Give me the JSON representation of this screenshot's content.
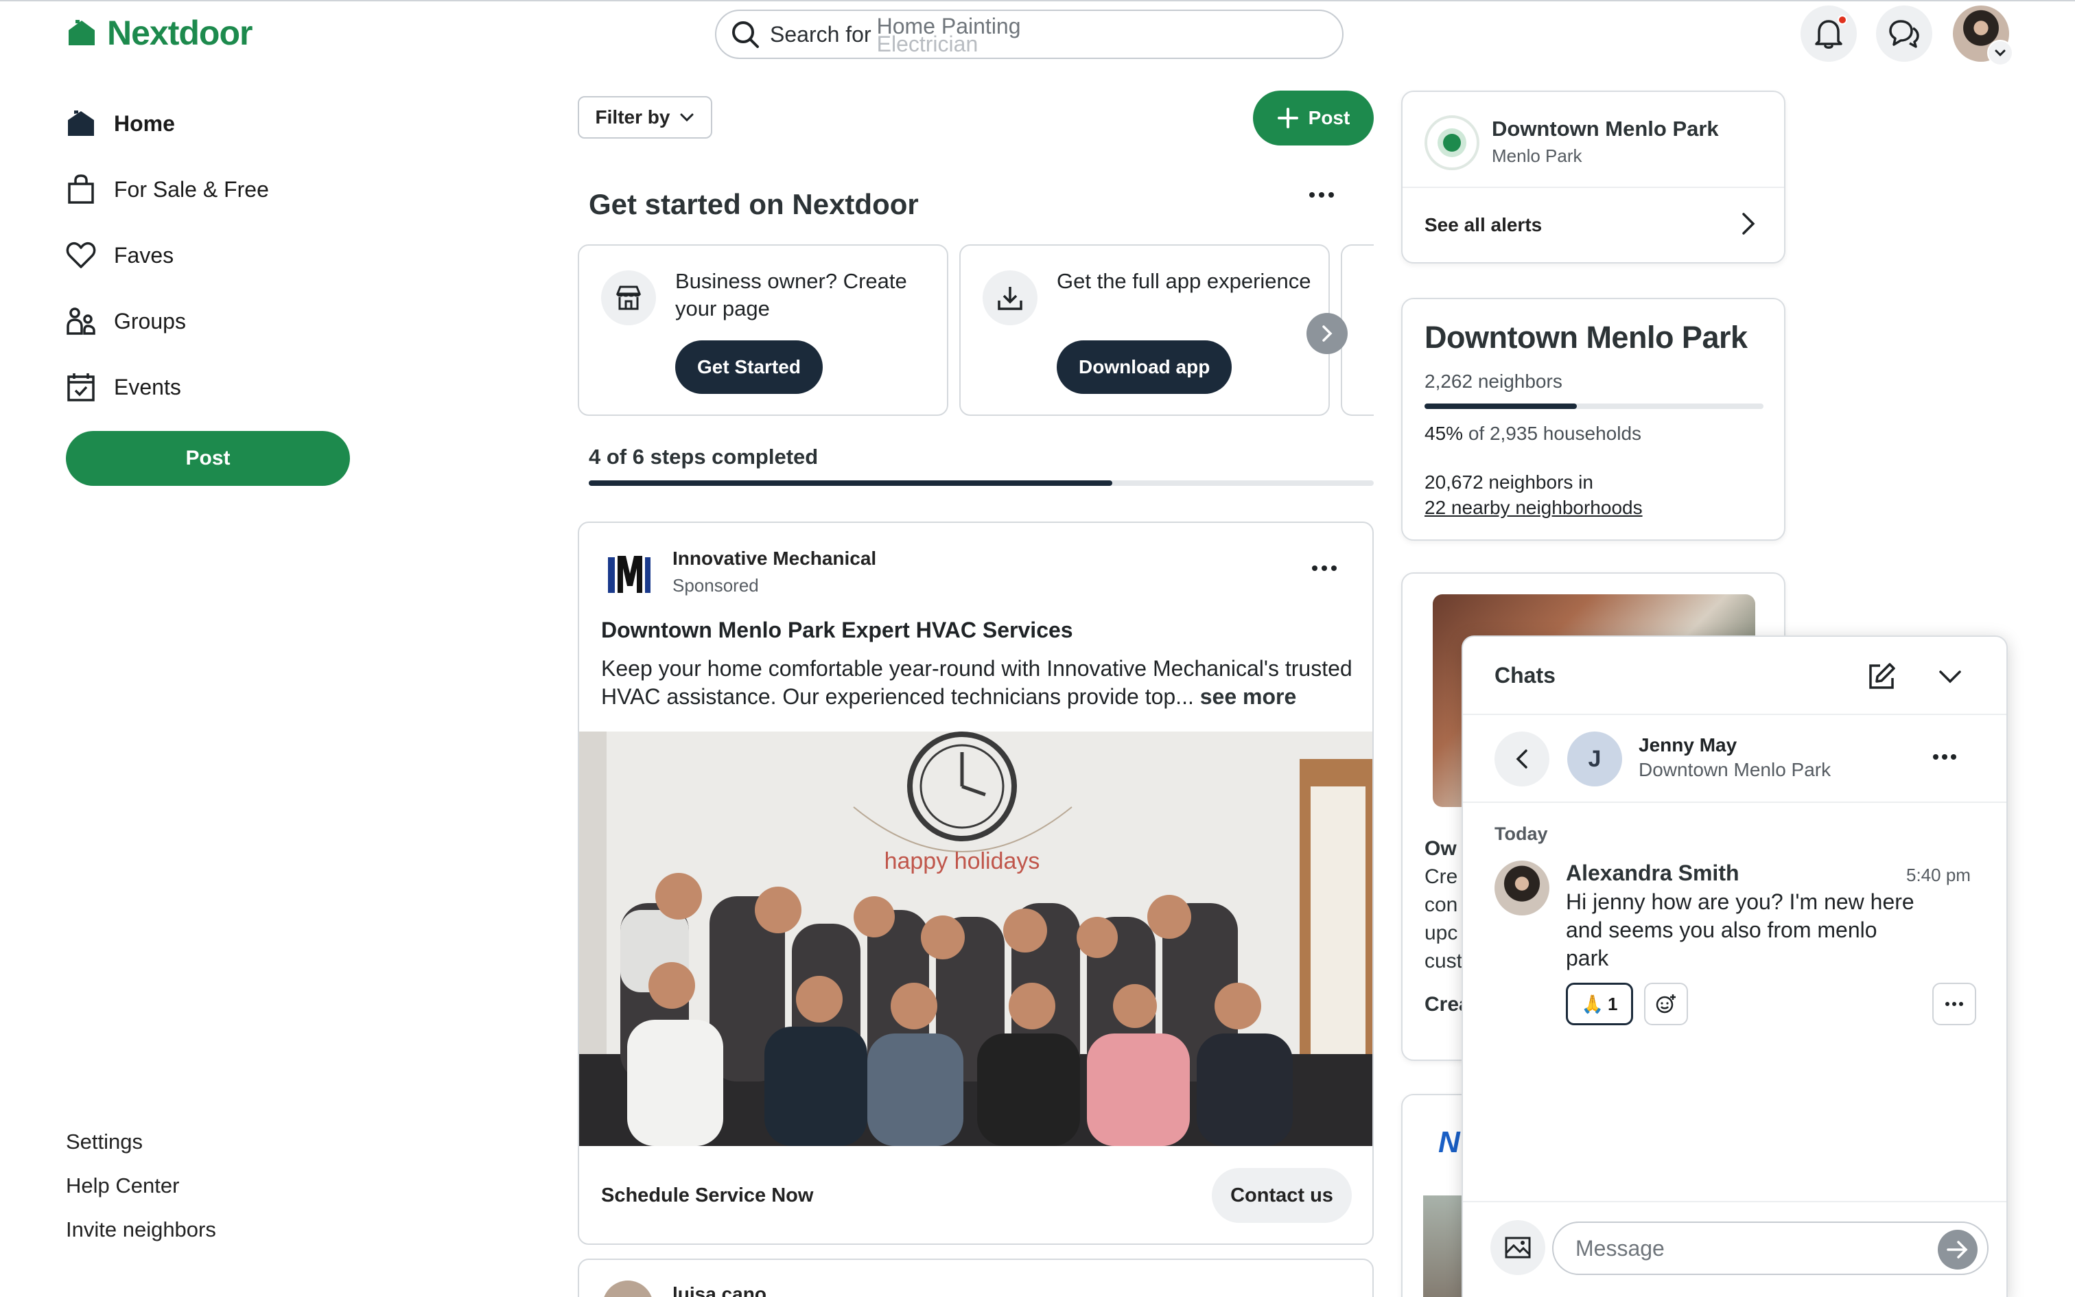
{
  "app": {
    "name": "Nextdoor",
    "brand_color": "#1d8a4d",
    "dark_color": "#1b2a3a"
  },
  "search": {
    "prefix": "Search for",
    "suggestion_current": "Home Painting",
    "suggestion_next": "Electrician"
  },
  "header": {
    "notification_icon": "bell-icon",
    "chat_icon": "chat-bubbles-icon",
    "has_unread_notification": true
  },
  "nav": {
    "items": [
      {
        "label": "Home",
        "icon": "home-icon",
        "active": true
      },
      {
        "label": "For Sale & Free",
        "icon": "shopping-bag-icon",
        "active": false
      },
      {
        "label": "Faves",
        "icon": "heart-icon",
        "active": false
      },
      {
        "label": "Groups",
        "icon": "people-icon",
        "active": false
      },
      {
        "label": "Events",
        "icon": "calendar-check-icon",
        "active": false
      }
    ],
    "post_label": "Post",
    "footer_links": [
      "Settings",
      "Help Center",
      "Invite neighbors"
    ]
  },
  "feed": {
    "filter_label": "Filter by",
    "post_label": "Post",
    "get_started": {
      "title": "Get started on Nextdoor",
      "cards": [
        {
          "text": "Business owner? Create your page",
          "button": "Get Started",
          "icon": "storefront-icon"
        },
        {
          "text": "Get the full app experience",
          "button": "Download app",
          "icon": "download-icon"
        }
      ],
      "steps_text": "4 of 6 steps completed",
      "steps_done": 4,
      "steps_total": 6
    },
    "ad": {
      "company": "Innovative Mechanical",
      "sponsored": "Sponsored",
      "headline": "Downtown Menlo Park Expert HVAC Services",
      "body": "Keep your home comfortable year-round with Innovative Mechanical's trusted HVAC assistance. Our experienced technicians provide top...",
      "see_more": "see more",
      "cta_text": "Schedule Service Now",
      "cta_button": "Contact us",
      "photo_banner": "happy holidays"
    },
    "next_post_author": "luisa cano"
  },
  "alerts": {
    "name": "Downtown Menlo Park",
    "sub": "Menlo Park",
    "link": "See all alerts"
  },
  "neighborhood": {
    "title": "Downtown Menlo Park",
    "neighbors": "2,262 neighbors",
    "households_pct": "45%",
    "households_text": "of 2,935 households",
    "households_fraction": 0.45,
    "nearby_line": "20,672 neighbors in",
    "nearby_link": "22 nearby neighborhoods"
  },
  "promo_partial": {
    "lines": [
      "Ow",
      "Cre",
      "con",
      "upc",
      "cust"
    ],
    "link": "Crea"
  },
  "chat": {
    "title": "Chats",
    "peer": {
      "initial": "J",
      "name": "Jenny May",
      "neighborhood": "Downtown Menlo Park"
    },
    "day": "Today",
    "message": {
      "author": "Alexandra Smith",
      "time": "5:40 pm",
      "text": "Hi jenny how are you? I'm new here and seems you also from menlo park",
      "reaction_emoji": "🙏",
      "reaction_count": "1"
    },
    "input_placeholder": "Message"
  }
}
